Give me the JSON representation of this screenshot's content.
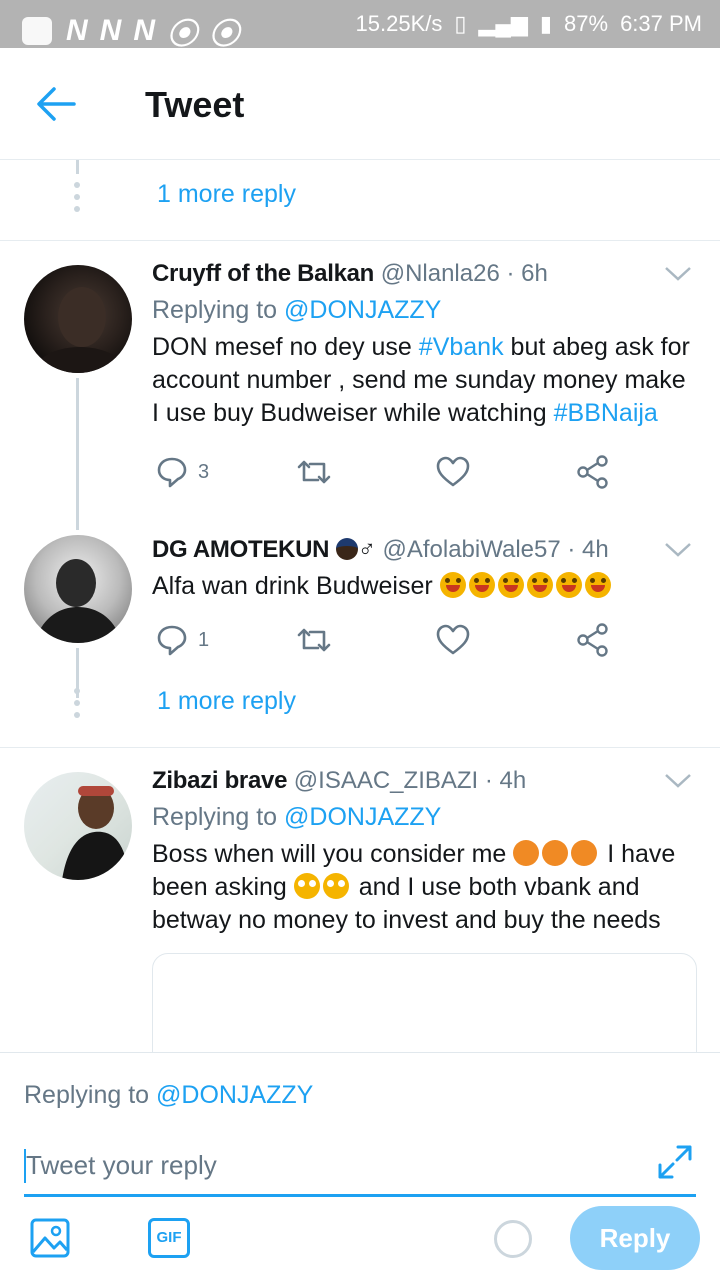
{
  "status_bar": {
    "speed": "15.25K/s",
    "battery": "87%",
    "time": "6:37 PM",
    "network_letter": "N"
  },
  "header": {
    "title": "Tweet"
  },
  "more_reply_1": "1 more reply",
  "tweets": [
    {
      "name": "Cruyff of the Balkan",
      "handle": "@Nlanla26",
      "time": "· 6h",
      "replying_prefix": "Replying to ",
      "replying_handle": "@DONJAZZY",
      "text_1": "DON mesef no dey use ",
      "tag_1": "#Vbank",
      "text_2": " but abeg ask for account number , send me sunday money make I use buy Budweiser while watching ",
      "tag_2": "#BBNaija",
      "reply_count": "3"
    },
    {
      "name": "DG AMOTEKUN",
      "name_suffix": "♂",
      "handle": "@AfolabiWale57",
      "time": "· 4h",
      "text": "Alfa wan drink Budweiser",
      "reply_count": "1"
    },
    {
      "name": "Zibazi brave",
      "handle": "@ISAAC_ZIBAZI",
      "time": "· 4h",
      "replying_prefix": "Replying to ",
      "replying_handle": "@DONJAZZY",
      "text_1": "Boss when will you consider me ",
      "text_2": " I have been asking ",
      "text_3": " and I use both vbank and betway no money to invest and buy the needs"
    }
  ],
  "more_reply_2": "1 more reply",
  "composer": {
    "replying_prefix": "Replying to ",
    "replying_handle": "@DONJAZZY",
    "placeholder": "Tweet your reply",
    "gif_label": "GIF",
    "reply_button": "Reply"
  },
  "colors": {
    "accent": "#1da1f2",
    "muted": "#657786",
    "reply_button_disabled": "#8ed0f9",
    "status_bar": "#b3b3b3"
  },
  "icons": [
    "back-arrow-icon",
    "chevron-down-icon",
    "reply-icon",
    "retweet-icon",
    "like-icon",
    "share-icon",
    "image-icon",
    "expand-icon"
  ]
}
